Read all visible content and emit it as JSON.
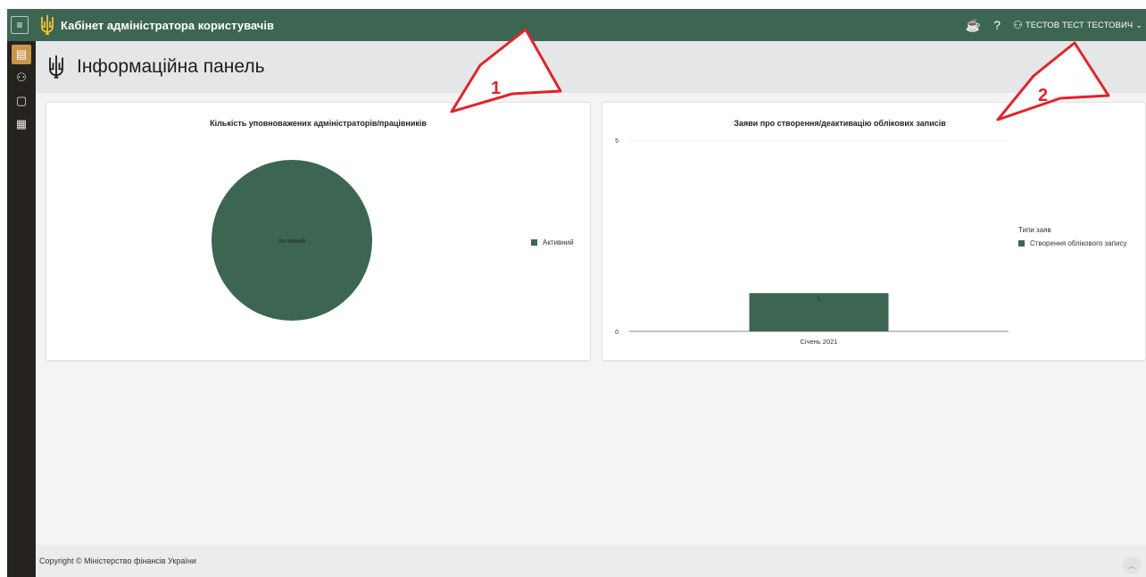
{
  "app": {
    "title": "Кабінет адміністратора користувачів",
    "user_name": "ТЕСТОВ ТЕСТ ТЕСТОВИЧ",
    "help_label": "?",
    "colors": {
      "header": "#3c6651",
      "sidebar": "#26231f",
      "accent": "#c9954a",
      "series": "#3c6651"
    }
  },
  "sidebar": {
    "items": [
      {
        "icon": "dashboard-chart-icon",
        "active": true
      },
      {
        "icon": "users-icon",
        "active": false
      },
      {
        "icon": "document-edit-icon",
        "active": false
      },
      {
        "icon": "registry-edit-icon",
        "active": false
      }
    ]
  },
  "page": {
    "title": "Інформаційна панель"
  },
  "annotations": [
    "1",
    "2"
  ],
  "chart_data": [
    {
      "type": "pie",
      "title": "Кількість уповноважених адміністраторів/працівників",
      "slices": [
        {
          "label": "Активний",
          "value": 1,
          "color": "#3c6651"
        }
      ],
      "legend": {
        "position": "right",
        "entries": [
          "Активний"
        ]
      }
    },
    {
      "type": "bar",
      "title": "Заяви про створення/деактивацію облікових записів",
      "categories": [
        "Січень 2021"
      ],
      "series": [
        {
          "name": "Створення облікового запису",
          "values": [
            1
          ],
          "color": "#3c6651"
        }
      ],
      "ylim": [
        0,
        5
      ],
      "yticks": [
        "0",
        "5"
      ],
      "grid": true,
      "legend": {
        "position": "right",
        "title": "Типи заяв",
        "entries": [
          "Створення облікового запису"
        ]
      }
    }
  ],
  "footer": {
    "copyright": "Copyright © Міністерство фінансів України"
  }
}
